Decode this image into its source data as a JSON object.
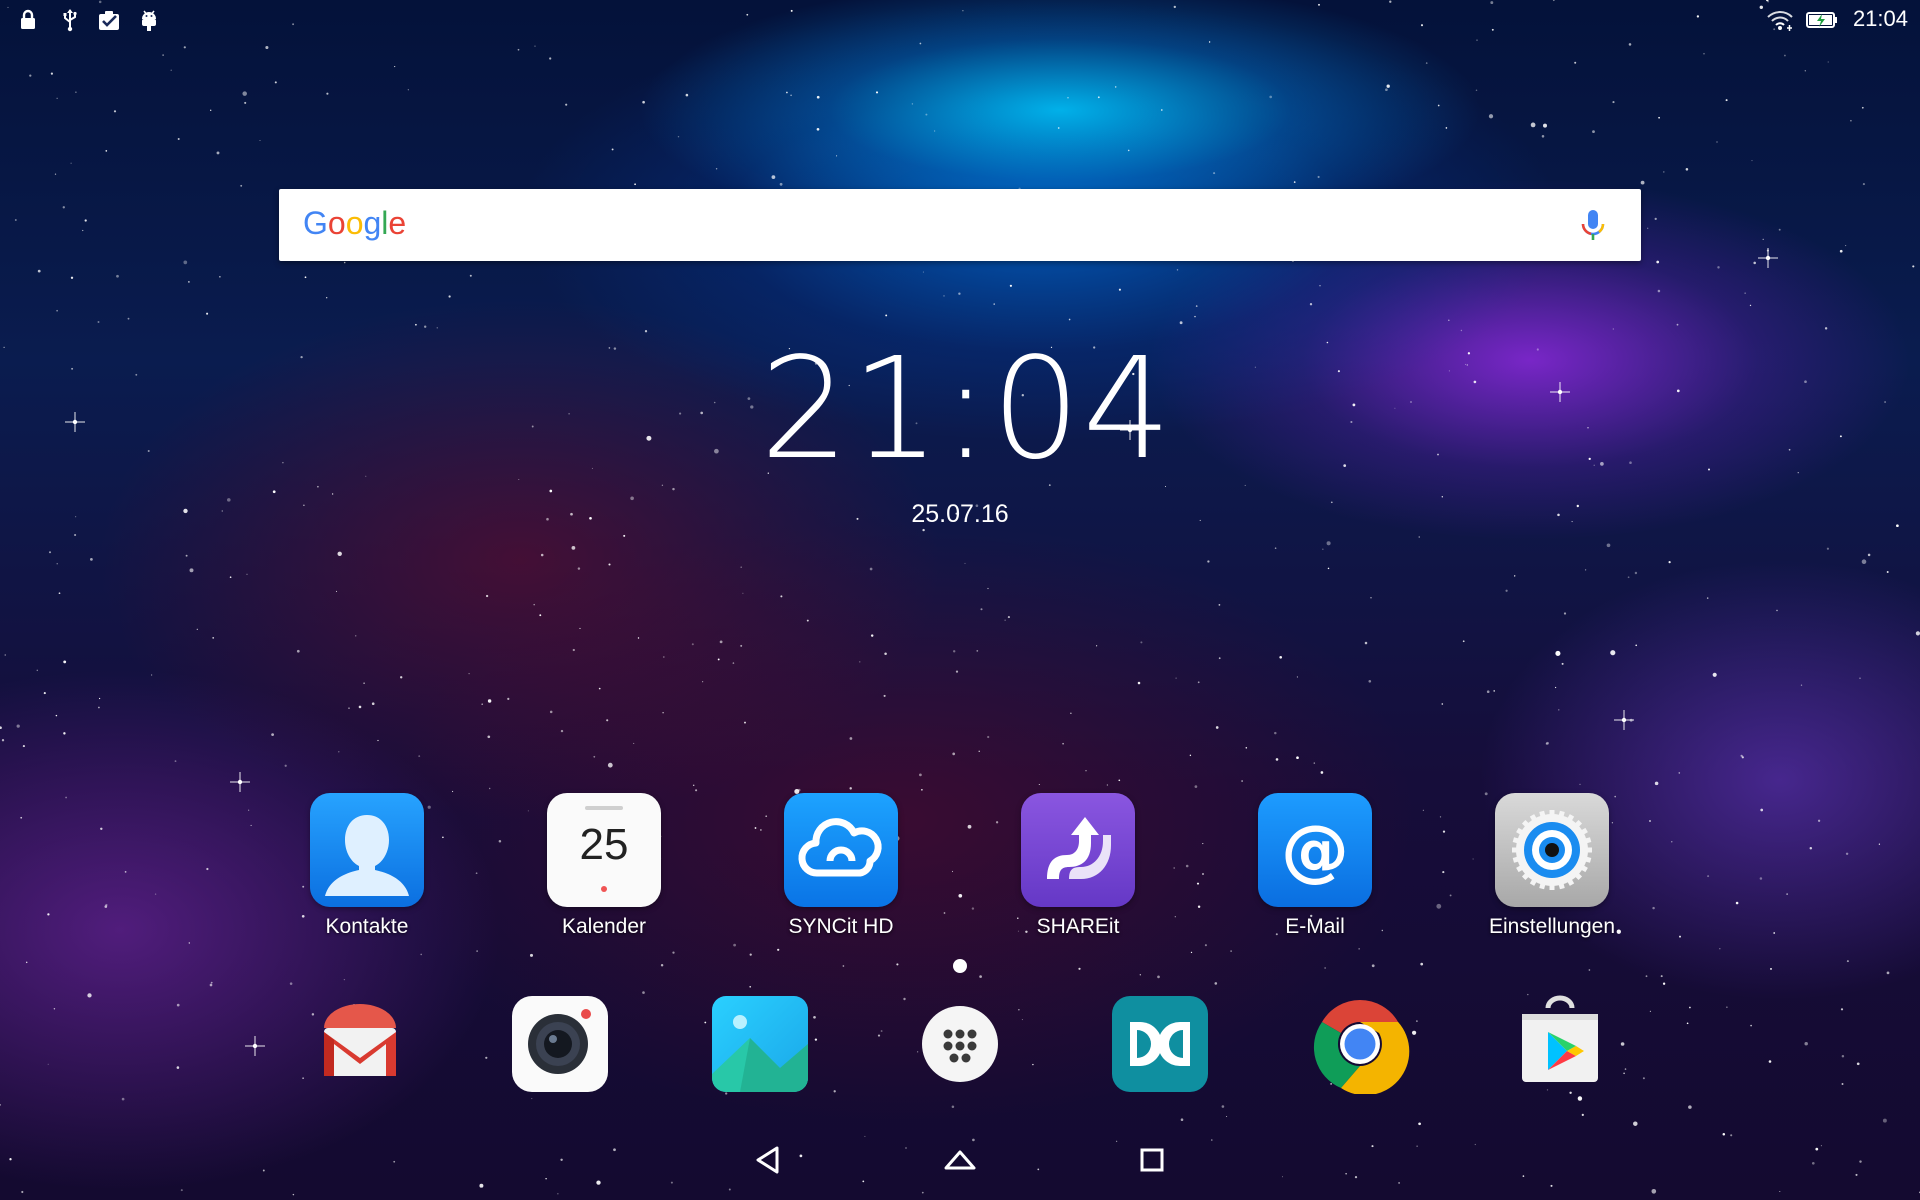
{
  "status_bar": {
    "left_icons": [
      "lock-icon",
      "usb-icon",
      "clipboard-check-icon",
      "android-debug-icon"
    ],
    "right_icons": [
      "wifi-icon",
      "battery-charging-icon"
    ],
    "time": "21:04"
  },
  "search": {
    "logo": "Google",
    "mic_icon": "mic-icon"
  },
  "clock": {
    "time": "21:04",
    "date": "25.07.16"
  },
  "apps": [
    {
      "label": "Kontakte",
      "icon": "contacts-icon"
    },
    {
      "label": "Kalender",
      "icon": "calendar-icon",
      "day": "25"
    },
    {
      "label": "SYNCit HD",
      "icon": "syncit-cloud-icon"
    },
    {
      "label": "SHAREit",
      "icon": "shareit-icon"
    },
    {
      "label": "E-Mail",
      "icon": "email-at-icon"
    },
    {
      "label": "Einstellungen",
      "icon": "settings-gear-icon"
    }
  ],
  "dock": [
    {
      "name": "gmail",
      "icon": "gmail-icon"
    },
    {
      "name": "camera",
      "icon": "camera-icon"
    },
    {
      "name": "gallery",
      "icon": "gallery-icon"
    },
    {
      "name": "app-drawer",
      "icon": "app-drawer-icon"
    },
    {
      "name": "dolby",
      "icon": "dolby-icon"
    },
    {
      "name": "chrome",
      "icon": "chrome-icon"
    },
    {
      "name": "play-store",
      "icon": "play-store-icon"
    }
  ],
  "nav": {
    "icons": [
      "back-icon",
      "home-icon",
      "recents-icon"
    ]
  },
  "colors": {
    "google_blue": "#4285F4",
    "google_red": "#EA4335",
    "google_yellow": "#FBBC05",
    "google_green": "#34A853",
    "app_blue": "#1a8cf0",
    "shareit_purple": "#7b4bd6",
    "dolby_teal": "#0f8fa0"
  }
}
